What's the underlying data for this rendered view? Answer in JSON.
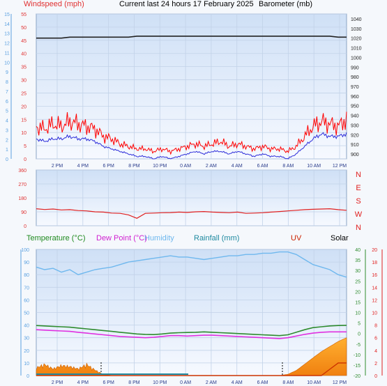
{
  "header": {
    "windspeed": "Windspeed (mph)",
    "title": "Current last 24 hours 17 February 2025",
    "barometer": "Barometer (mb)",
    "overlap_hint": "Humidity"
  },
  "legend2": {
    "temperature": "Temperature (°C)",
    "dewpoint": "Dew Point (°C)",
    "humidity": "Humidity",
    "rainfall": "Rainfall (mm)",
    "uv": "UV",
    "solar": "Solar"
  },
  "colors": {
    "wind": "#ff0000",
    "wind_avg": "#2b2bd9",
    "baro": "#222222",
    "dir": "#e02020",
    "temp": "#2e8b2e",
    "dew": "#e030e0",
    "hum": "#6fb8ee",
    "rain": "#1f8aa0",
    "uv": "#cc3300",
    "solar": "#f59a1a",
    "left_axis": "#e03030",
    "left_axis2": "#5aa0e0",
    "right_axis": "#222222",
    "right_green": "#2e8b2e",
    "right_red": "#e02020"
  },
  "chart_data": [
    {
      "type": "line",
      "title": "Current last 24 hours 17 February 2025",
      "x_ticks": [
        "2 PM",
        "4 PM",
        "6 PM",
        "8 PM",
        "10 PM",
        "0 AM",
        "2 AM",
        "4 AM",
        "6 AM",
        "8 AM",
        "10 AM",
        "12 PM"
      ],
      "y_left_ticks": [
        "0",
        "5",
        "10",
        "15",
        "20",
        "25",
        "30",
        "35",
        "40",
        "45",
        "50",
        "55"
      ],
      "y_left2_ticks": [
        "0",
        "1",
        "2",
        "3",
        "4",
        "5",
        "6",
        "7",
        "8",
        "9",
        "10",
        "11",
        "12",
        "13",
        "14",
        "15"
      ],
      "y_right_ticks": [
        "900",
        "910",
        "920",
        "930",
        "940",
        "950",
        "960",
        "970",
        "980",
        "990",
        "1000",
        "1010",
        "1020",
        "1030",
        "1040"
      ],
      "ylim_left": [
        0,
        58
      ],
      "ylim_right": [
        895,
        1045
      ],
      "series": [
        {
          "name": "Windspeed (mph)",
          "color": "#ff0000",
          "values": [
            13,
            12,
            14,
            13,
            15,
            14,
            13,
            12,
            9,
            8,
            6,
            5,
            4,
            4,
            3,
            4,
            3,
            4,
            5,
            6,
            5,
            6,
            7,
            5,
            6,
            5,
            4,
            5,
            4,
            4,
            3,
            5,
            9,
            13,
            15,
            14,
            13,
            16
          ]
        },
        {
          "name": "",
          "color": "#2b2bd9",
          "values": [
            8,
            7,
            8,
            8,
            9,
            8,
            8,
            7,
            5,
            4,
            3,
            2,
            1,
            1,
            0,
            1,
            0,
            1,
            2,
            3,
            2,
            3,
            3,
            2,
            3,
            2,
            1,
            2,
            1,
            1,
            0,
            2,
            5,
            8,
            10,
            9,
            9,
            10
          ]
        },
        {
          "name": "Barometer (mb)",
          "color": "#222222",
          "values": [
            1020,
            1020,
            1020,
            1020,
            1021,
            1021,
            1021,
            1021,
            1021,
            1021,
            1021,
            1021,
            1022,
            1022,
            1022,
            1022,
            1022,
            1022,
            1022,
            1022,
            1022,
            1022,
            1022,
            1022,
            1022,
            1022,
            1022,
            1022,
            1022,
            1022,
            1022,
            1022,
            1022,
            1022,
            1022,
            1022,
            1021,
            1021
          ]
        }
      ]
    },
    {
      "type": "line",
      "y_ticks": [
        "0",
        "90",
        "180",
        "270",
        "360"
      ],
      "dir_labels": [
        "N",
        "W",
        "S",
        "E",
        "N"
      ],
      "ylim": [
        0,
        360
      ],
      "series": [
        {
          "name": "",
          "color": "#e02020",
          "values": [
            110,
            105,
            108,
            102,
            104,
            98,
            96,
            90,
            88,
            82,
            80,
            70,
            48,
            80,
            82,
            84,
            85,
            88,
            86,
            90,
            92,
            88,
            86,
            84,
            88,
            80,
            82,
            84,
            88,
            92,
            96,
            100,
            104,
            106,
            108,
            110,
            104,
            100
          ]
        }
      ]
    },
    {
      "type": "line",
      "x_ticks": [
        "2 PM",
        "4 PM",
        "6 PM",
        "8 PM",
        "10 PM",
        "0 AM",
        "2 AM",
        "4 AM",
        "6 AM",
        "8 AM",
        "10 AM",
        "12 PM"
      ],
      "y_left_ticks": [
        "0",
        "10",
        "20",
        "30",
        "40",
        "50",
        "60",
        "70",
        "80",
        "90",
        "100"
      ],
      "y_right_green_ticks": [
        "-20",
        "-15",
        "-10",
        "-5",
        "0",
        "5",
        "10",
        "15",
        "20",
        "25",
        "30",
        "35",
        "40"
      ],
      "y_right_red_ticks": [
        "0",
        "2",
        "4",
        "6",
        "8",
        "10",
        "12",
        "14",
        "16",
        "18",
        "20"
      ],
      "series": [
        {
          "name": "Humidity",
          "color": "#6fb8ee",
          "values": [
            86,
            84,
            85,
            82,
            84,
            80,
            82,
            84,
            85,
            86,
            88,
            90,
            91,
            92,
            93,
            94,
            95,
            94,
            94,
            93,
            92,
            93,
            94,
            95,
            95,
            96,
            96,
            97,
            97,
            98,
            98,
            96,
            92,
            88,
            86,
            84,
            80,
            78
          ]
        },
        {
          "name": "Temperature (°C)",
          "color": "#2e8b2e",
          "values": [
            3.8,
            3.6,
            3.4,
            3.2,
            3.0,
            2.6,
            2.2,
            1.8,
            1.4,
            1.0,
            0.6,
            0.2,
            -0.2,
            -0.4,
            -0.5,
            -0.2,
            0.2,
            0.4,
            0.5,
            0.6,
            0.8,
            0.6,
            0.4,
            0.2,
            0.0,
            -0.2,
            -0.4,
            -0.6,
            -0.8,
            -1.0,
            -0.6,
            0.6,
            1.8,
            2.8,
            3.2,
            3.6,
            3.8,
            3.9
          ]
        },
        {
          "name": "Dew Point (°C)",
          "color": "#e030e0",
          "values": [
            1.8,
            1.6,
            1.4,
            1.2,
            1.0,
            0.6,
            0.2,
            -0.2,
            -0.6,
            -1.0,
            -1.4,
            -1.6,
            -1.8,
            -2.0,
            -1.8,
            -1.4,
            -1.0,
            -1.0,
            -1.2,
            -1.0,
            -0.8,
            -0.8,
            -1.0,
            -1.2,
            -1.4,
            -1.6,
            -1.8,
            -2.0,
            -2.2,
            -2.4,
            -2.0,
            -1.2,
            -0.4,
            0.2,
            0.6,
            0.8,
            0.8,
            0.8
          ]
        },
        {
          "name": "Solar",
          "color": "#f59a1a",
          "values": [
            7,
            10,
            6,
            9,
            8,
            6,
            10,
            5,
            1,
            0,
            0,
            0,
            0,
            0,
            0,
            0,
            0,
            0,
            0,
            0,
            0,
            0,
            0,
            0,
            0,
            0,
            0,
            0,
            0,
            0,
            1,
            4,
            9,
            14,
            19,
            23,
            27,
            30
          ]
        },
        {
          "name": "UV",
          "color": "#cc3300",
          "values": [
            0,
            0,
            0,
            0,
            0,
            0,
            0,
            0,
            0,
            0,
            0,
            0,
            0,
            0,
            0,
            0,
            0,
            0,
            0,
            0,
            0,
            0,
            0,
            0,
            0,
            0,
            0,
            0,
            0,
            0,
            0,
            0,
            0,
            0,
            0,
            1,
            2,
            2
          ]
        },
        {
          "name": "Rainfall (mm)",
          "color": "#1f8aa0",
          "values": [
            0,
            0,
            0,
            0,
            0,
            0,
            0,
            0,
            0,
            0,
            0,
            0,
            0,
            0,
            0,
            0,
            0,
            0,
            0,
            0,
            0,
            0,
            0,
            0,
            0,
            0,
            0,
            0,
            0,
            0,
            0,
            0,
            0,
            0,
            0,
            0,
            0,
            0
          ]
        }
      ]
    }
  ]
}
